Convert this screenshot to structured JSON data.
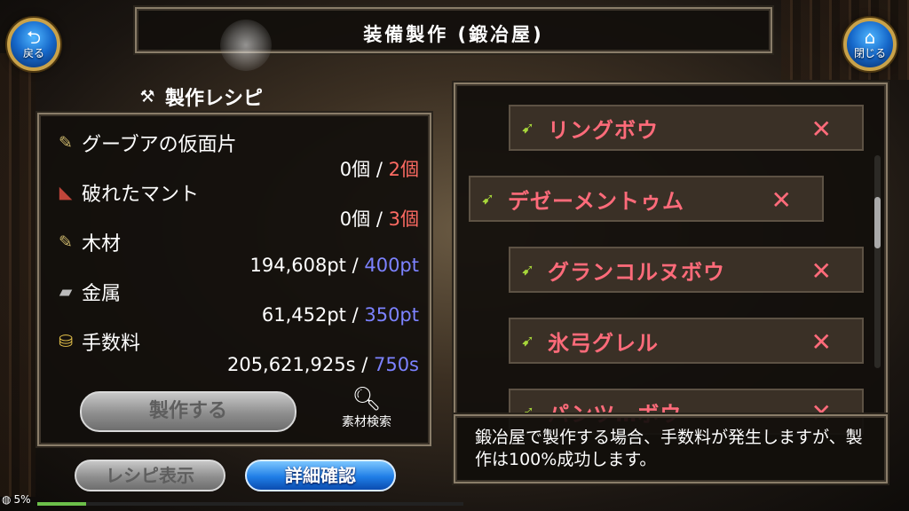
{
  "header": {
    "title": "装備製作 (鍛冶屋)",
    "back_label": "戻る",
    "close_label": "閉じる"
  },
  "recipe": {
    "title": "製作レシピ",
    "materials": [
      {
        "name": "グーブアの仮面片",
        "icon": "bow-fragment-icon",
        "have": "0個",
        "sep": "/",
        "need": "2個",
        "need_color": "red"
      },
      {
        "name": "破れたマント",
        "icon": "torn-cloak-icon",
        "have": "0個",
        "sep": "/",
        "need": "3個",
        "need_color": "red"
      },
      {
        "name": "木材",
        "icon": "wood-icon",
        "have": "194,608pt",
        "sep": "/",
        "need": "400pt",
        "need_color": "blue"
      },
      {
        "name": "金属",
        "icon": "metal-icon",
        "have": "61,452pt",
        "sep": "/",
        "need": "350pt",
        "need_color": "blue"
      },
      {
        "name": "手数料",
        "icon": "coin-icon",
        "have": "205,621,925s",
        "sep": "/",
        "need": "750s",
        "need_color": "blue"
      }
    ],
    "craft_label": "製作する",
    "search_label": "素材検索"
  },
  "bottom_buttons": {
    "recipe_view": "レシピ表示",
    "detail_confirm": "詳細確認"
  },
  "weapon_list": [
    {
      "name": "リングボウ",
      "mark": "✕"
    },
    {
      "name": "デゼーメントゥム",
      "mark": "✕"
    },
    {
      "name": "グランコルヌボウ",
      "mark": "✕"
    },
    {
      "name": "氷弓グレル",
      "mark": "✕"
    },
    {
      "name": "パンツ…ボウ",
      "mark": "✕"
    }
  ],
  "info": {
    "text": "鍛冶屋で製作する場合、手数料が発生しますが、製作は100%成功します。"
  },
  "status": {
    "percent": "5%"
  },
  "colors": {
    "need_red": "#ff6b63",
    "need_blue": "#7c82ff",
    "weapon_name": "#ff6b7a",
    "accent_blue": "#1f7ee6"
  }
}
